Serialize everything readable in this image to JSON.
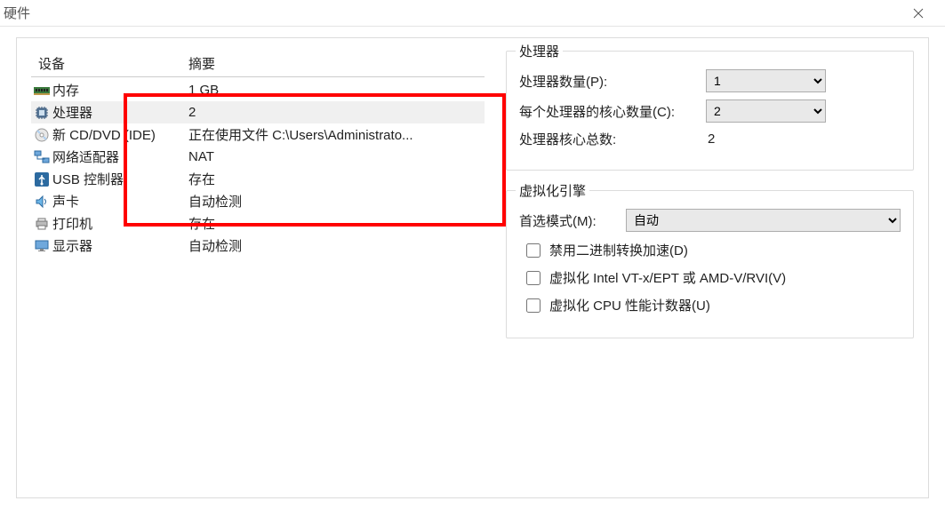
{
  "window": {
    "title": "硬件"
  },
  "devices": {
    "headers": {
      "device": "设备",
      "summary": "摘要"
    },
    "items": [
      {
        "name": "内存",
        "summary": "1 GB",
        "icon": "memory"
      },
      {
        "name": "处理器",
        "summary": "2",
        "icon": "cpu",
        "selected": true
      },
      {
        "name": "新 CD/DVD (IDE)",
        "summary": "正在使用文件 C:\\Users\\Administrato...",
        "icon": "disc"
      },
      {
        "name": "网络适配器",
        "summary": "NAT",
        "icon": "network"
      },
      {
        "name": "USB 控制器",
        "summary": "存在",
        "icon": "usb"
      },
      {
        "name": "声卡",
        "summary": "自动检测",
        "icon": "sound"
      },
      {
        "name": "打印机",
        "summary": "存在",
        "icon": "printer"
      },
      {
        "name": "显示器",
        "summary": "自动检测",
        "icon": "display"
      }
    ]
  },
  "processor": {
    "legend": "处理器",
    "count_label": "处理器数量(P):",
    "count_value": "1",
    "cores_label": "每个处理器的核心数量(C):",
    "cores_value": "2",
    "total_label": "处理器核心总数:",
    "total_value": "2"
  },
  "virt": {
    "legend": "虚拟化引擎",
    "mode_label": "首选模式(M):",
    "mode_value": "自动",
    "chk_binary": "禁用二进制转换加速(D)",
    "chk_vtx": "虚拟化 Intel VT-x/EPT 或 AMD-V/RVI(V)",
    "chk_perf": "虚拟化 CPU 性能计数器(U)"
  }
}
